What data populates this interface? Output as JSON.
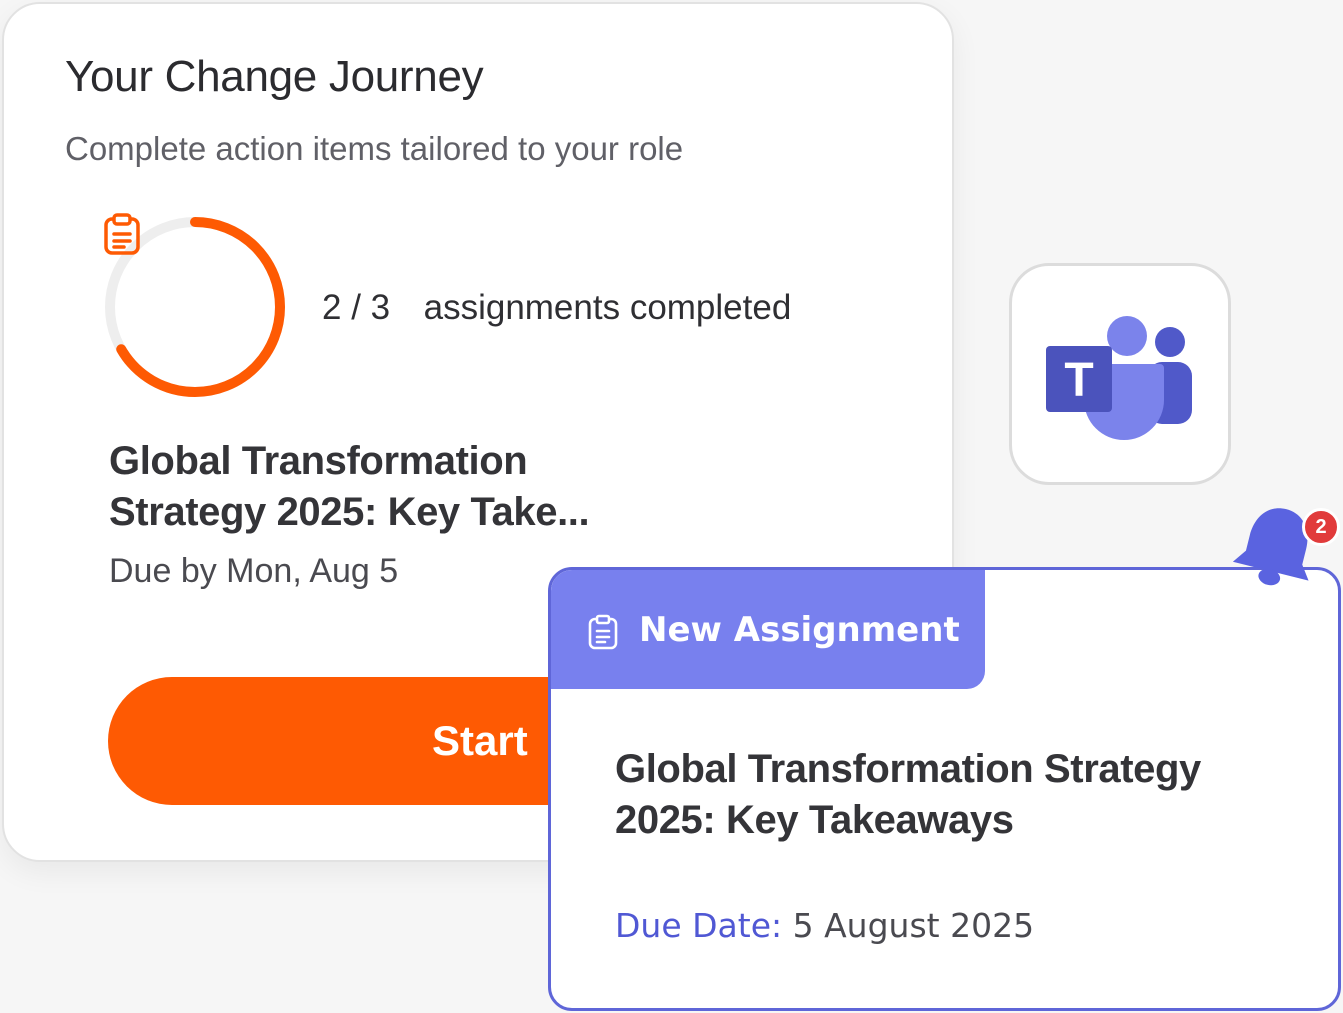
{
  "journey": {
    "title": "Your Change Journey",
    "subtitle": "Complete action items tailored to your role",
    "progress": {
      "completed": "2",
      "separator": "/",
      "total": "3",
      "label": "assignments completed",
      "fraction": 0.667,
      "ring_color": "#fe5a03",
      "track_color": "#eeeeee",
      "icon": "clipboard-icon"
    },
    "assignment": {
      "title": "Global Transformation Strategy 2025: Key Take...",
      "due": "Due by Mon, Aug 5"
    },
    "start_button": {
      "label": "Start",
      "color": "#fe5a03"
    }
  },
  "teams_app": {
    "icon": "microsoft-teams-icon",
    "letter": "T"
  },
  "notification": {
    "header_icon": "clipboard-icon",
    "header_label": "New Assignment",
    "header_color": "#7880ee",
    "title": "Global Transformation Strategy 2025: Key Takeaways",
    "due_label": "Due Date:",
    "due_value": "5 August 2025",
    "bell": {
      "icon": "bell-icon",
      "badge_count": "2"
    }
  }
}
